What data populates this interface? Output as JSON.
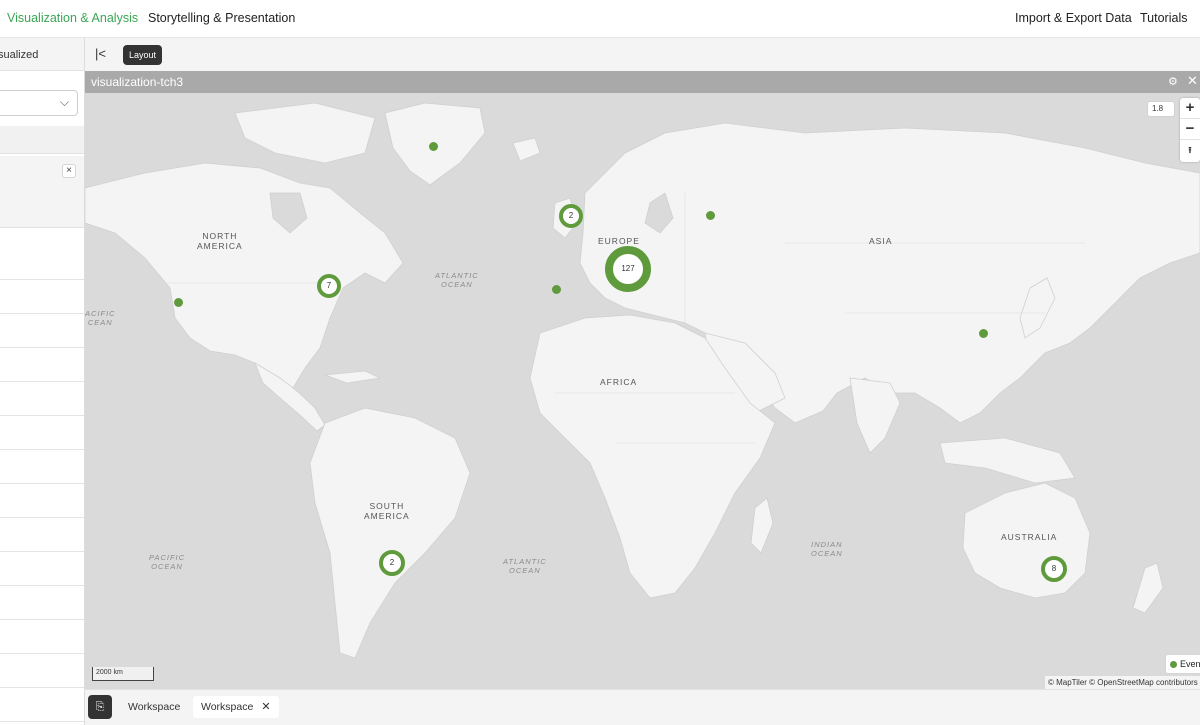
{
  "nav": {
    "left": [
      "Visualization & Analysis",
      "Storytelling & Presentation"
    ],
    "right": [
      "Import & Export Data",
      "Tutorials"
    ]
  },
  "sidebar": {
    "header": "sualized",
    "close_glyph": "×",
    "chevron_glyph": "⌵"
  },
  "toolbar": {
    "collapse_glyph": "|<",
    "tooltip": "Layout"
  },
  "panel": {
    "title": "visualization-tch3",
    "settings_glyph": "⚙",
    "close_glyph": "✕"
  },
  "map": {
    "zoom_level": "1.8",
    "zoom_in": "+",
    "zoom_out": "−",
    "reset": "⭱",
    "scale": "2000 km",
    "attribution": "© MapTiler © OpenStreetMap contributors",
    "legend_label": "Even",
    "colors": {
      "marker": "#5f9a3c",
      "land": "#f4f4f4",
      "water": "#dadada",
      "border": "#d0d0d0"
    },
    "continent_labels": [
      {
        "text": "NORTH\nAMERICA"
      },
      {
        "text": "EUROPE"
      },
      {
        "text": "ASIA"
      },
      {
        "text": "AFRICA"
      },
      {
        "text": "SOUTH\nAMERICA"
      },
      {
        "text": "AUSTRALIA"
      }
    ],
    "ocean_labels": [
      {
        "text": "ATLANTIC\nOCEAN"
      },
      {
        "text": "ACIFIC\nCEAN"
      },
      {
        "text": "PACIFIC\nOCEAN"
      },
      {
        "text": "ATLANTIC\nOCEAN"
      },
      {
        "text": "INDIAN\nOCEAN"
      }
    ],
    "clusters": [
      {
        "count": "2"
      },
      {
        "count": "127"
      },
      {
        "count": "7"
      },
      {
        "count": "2"
      },
      {
        "count": "8"
      }
    ],
    "point_count": 5
  },
  "workspace": {
    "icon": "⎘",
    "tabs": [
      "Workspace",
      "Workspace"
    ],
    "close_glyph": "✕"
  }
}
